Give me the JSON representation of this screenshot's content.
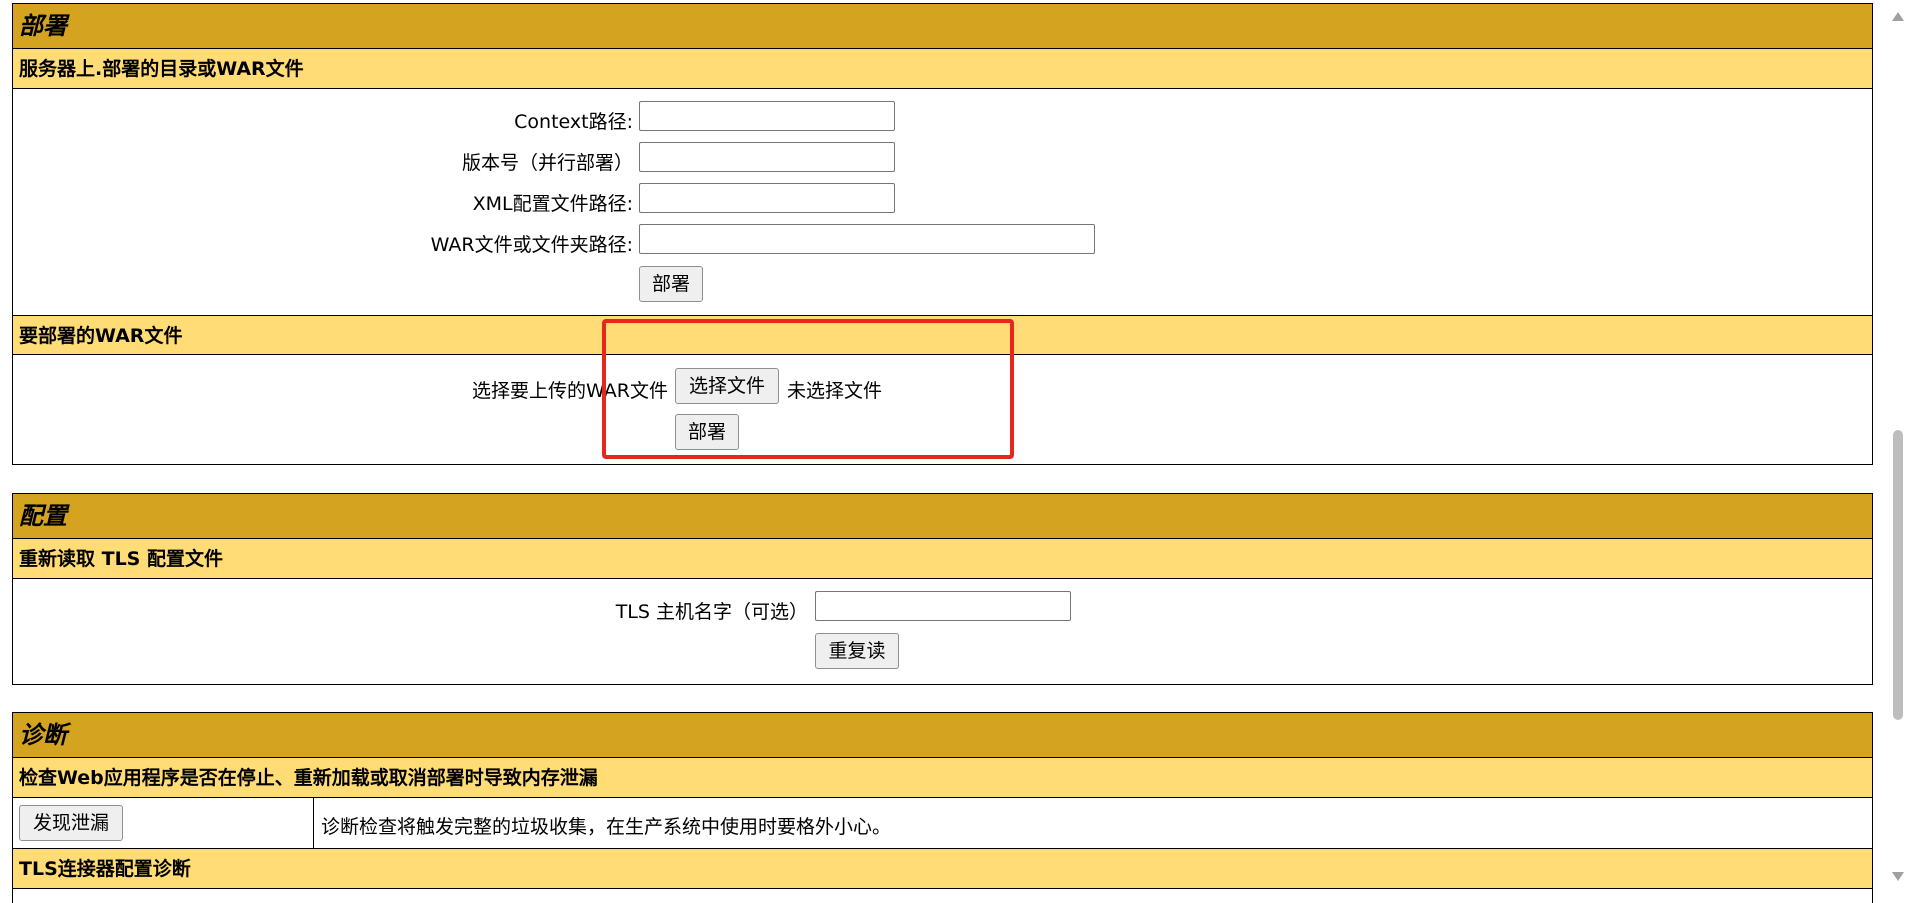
{
  "deploy": {
    "title": "部署",
    "server_section": {
      "title": "服务器上.部署的目录或WAR文件",
      "context_label": "Context路径:",
      "context_value": "",
      "version_label": "版本号（并行部署）",
      "version_value": "",
      "xml_label": "XML配置文件路径:",
      "xml_value": "",
      "war_label": "WAR文件或文件夹路径:",
      "war_value": "",
      "deploy_button": "部署"
    },
    "upload_section": {
      "title": "要部署的WAR文件",
      "choose_label": "选择要上传的WAR文件",
      "choose_button": "选择文件",
      "no_file_text": "未选择文件",
      "deploy_button": "部署"
    }
  },
  "config": {
    "title": "配置",
    "tls_section": {
      "title": "重新读取 TLS 配置文件",
      "host_label": "TLS 主机名字（可选）",
      "host_value": "",
      "reload_button": "重复读"
    }
  },
  "diagnostics": {
    "title": "诊断",
    "leak_section": {
      "title": "检查Web应用程序是否在停止、重新加载或取消部署时导致内存泄漏",
      "find_button": "发现泄漏",
      "description": "诊断检查将触发完整的垃圾收集，在生产系统中使用时要格外小心。"
    },
    "tls_diag_section": {
      "title": "TLS连接器配置诊断"
    }
  },
  "colors": {
    "header_dark": "#D4A420",
    "header_light": "#FFDC75",
    "highlight_box": "#E8261E"
  }
}
